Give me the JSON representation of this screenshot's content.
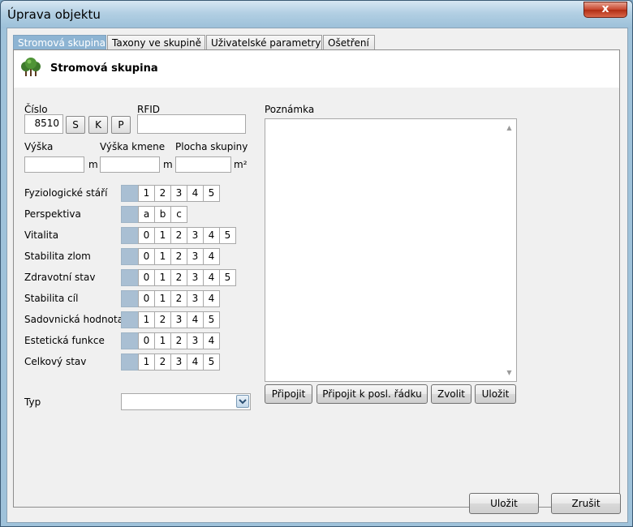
{
  "window": {
    "title": "Úprava objektu",
    "close_label": "x"
  },
  "tabs": [
    {
      "label": "Stromová skupina"
    },
    {
      "label": "Taxony ve skupině"
    },
    {
      "label": "Uživatelské parametry"
    },
    {
      "label": "Ošetření"
    }
  ],
  "header": {
    "title": "Stromová skupina",
    "icon": "tree-group-icon"
  },
  "form": {
    "cislo": {
      "label": "Číslo",
      "value": "8510"
    },
    "cislo_buttons": {
      "s": "S",
      "k": "K",
      "p": "P"
    },
    "rfid": {
      "label": "RFID",
      "value": ""
    },
    "vyska": {
      "label": "Výška",
      "unit": "m",
      "value": ""
    },
    "vyska_kmene": {
      "label": "Výška kmene",
      "unit": "m",
      "value": ""
    },
    "plocha": {
      "label": "Plocha skupiny",
      "unit": "m²",
      "value": ""
    },
    "scales": [
      {
        "label": "Fyziologické stáří",
        "options": [
          "1",
          "2",
          "3",
          "4",
          "5"
        ]
      },
      {
        "label": "Perspektiva",
        "options": [
          "a",
          "b",
          "c"
        ]
      },
      {
        "label": "Vitalita",
        "options": [
          "0",
          "1",
          "2",
          "3",
          "4",
          "5"
        ]
      },
      {
        "label": "Stabilita zlom",
        "options": [
          "0",
          "1",
          "2",
          "3",
          "4"
        ]
      },
      {
        "label": "Zdravotní stav",
        "options": [
          "0",
          "1",
          "2",
          "3",
          "4",
          "5"
        ]
      },
      {
        "label": "Stabilita cíl",
        "options": [
          "0",
          "1",
          "2",
          "3",
          "4"
        ]
      },
      {
        "label": "Sadovnická hodnota",
        "options": [
          "1",
          "2",
          "3",
          "4",
          "5"
        ]
      },
      {
        "label": "Estetická funkce",
        "options": [
          "0",
          "1",
          "2",
          "3",
          "4"
        ]
      },
      {
        "label": "Celkový stav",
        "options": [
          "1",
          "2",
          "3",
          "4",
          "5"
        ]
      }
    ],
    "typ": {
      "label": "Typ",
      "value": ""
    }
  },
  "note": {
    "label": "Poznámka",
    "value": "",
    "buttons": {
      "pripojit": "Připojit",
      "pripojit_k_radku": "Připojit k posl. řádku",
      "zvolit": "Zvolit",
      "ulozit": "Uložit"
    }
  },
  "footer": {
    "save": "Uložit",
    "cancel": "Zrušit"
  }
}
